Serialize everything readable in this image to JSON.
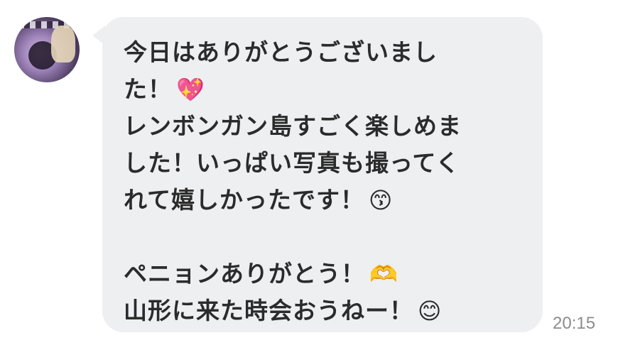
{
  "message": {
    "lines": [
      "今日はありがとうございまし",
      "た！",
      "レンボンガン島すごく楽しめま",
      "した！いっぱい写真も撮ってく",
      "れて嬉しかったです！",
      "",
      "ペニョンありがとう！",
      "山形に来た時会おうねー！"
    ],
    "emojis": {
      "sparkling_heart": "💖",
      "kissing_face": "😙",
      "heart_hands": "🫶",
      "smiling_face": "😊"
    }
  },
  "timestamp": "20:15",
  "colors": {
    "bubble": "#eeeff1",
    "text": "#2b2b2b",
    "timestamp": "#8c8c8c"
  }
}
